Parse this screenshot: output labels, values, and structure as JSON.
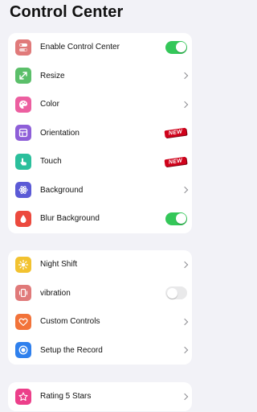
{
  "header": {
    "title": "Control Center"
  },
  "sections": [
    {
      "items": [
        {
          "label": "Enable Control Center",
          "icon": "toggle-switch-icon",
          "icon_bg": "#e07a7a",
          "accessory": "toggle",
          "on": true
        },
        {
          "label": "Resize",
          "icon": "resize-arrows-icon",
          "icon_bg": "#5bbf6a",
          "accessory": "chevron"
        },
        {
          "label": "Color",
          "icon": "palette-icon",
          "icon_bg": "#ec5fa0",
          "accessory": "chevron"
        },
        {
          "label": "Orientation",
          "icon": "orientation-icon",
          "icon_bg": "#8e5fd8",
          "accessory": "badge",
          "badge": "NEW"
        },
        {
          "label": "Touch",
          "icon": "touch-hand-icon",
          "icon_bg": "#2bbf9c",
          "accessory": "badge",
          "badge": "NEW"
        },
        {
          "label": "Background",
          "icon": "atom-icon",
          "icon_bg": "#5b5ad6",
          "accessory": "chevron"
        },
        {
          "label": "Blur Background",
          "icon": "blur-drop-icon",
          "icon_bg": "#ec4a3e",
          "accessory": "toggle",
          "on": true
        }
      ]
    },
    {
      "items": [
        {
          "label": "Night Shift",
          "icon": "sun-icon",
          "icon_bg": "#f2c230",
          "accessory": "chevron"
        },
        {
          "label": "vibration",
          "icon": "vibration-phone-icon",
          "icon_bg": "#e07a7a",
          "accessory": "toggle",
          "on": false
        },
        {
          "label": "Custom Controls",
          "icon": "heart-icon",
          "icon_bg": "#f2733a",
          "accessory": "chevron"
        },
        {
          "label": "Setup the Record",
          "icon": "record-icon",
          "icon_bg": "#2f80ed",
          "accessory": "chevron"
        }
      ]
    },
    {
      "items": [
        {
          "label": "Rating 5 Stars",
          "icon": "star-icon",
          "icon_bg": "#ec3f8a",
          "accessory": "chevron"
        }
      ]
    }
  ],
  "colors": {
    "accent_toggle": "#34c759",
    "background": "#f2f2f7",
    "badge_red": "#d0021b"
  }
}
